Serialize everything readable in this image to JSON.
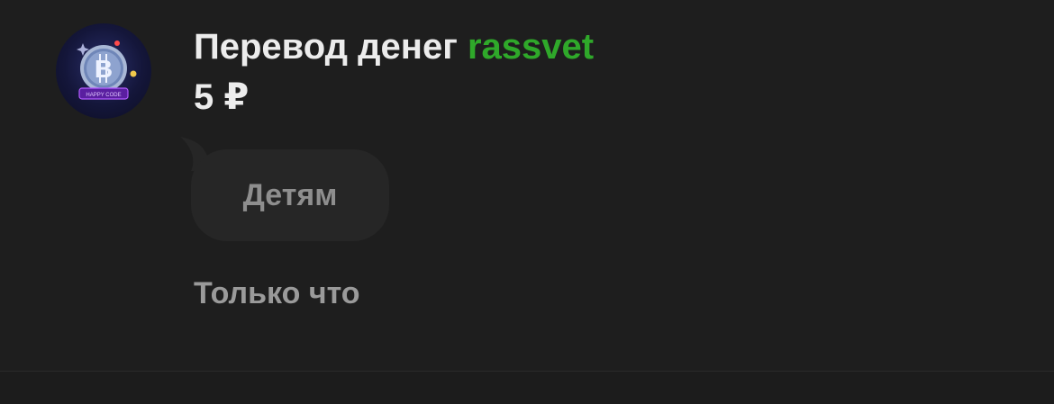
{
  "notification": {
    "avatar_icon": "bitcoin-logo-icon",
    "avatar_badge_text": "HAPPY CODE",
    "title_prefix": "Перевод денег",
    "username": "rassvet",
    "amount": "5 ₽",
    "message": "Детям",
    "timestamp": "Только что"
  },
  "colors": {
    "background": "#1e1e1e",
    "username": "#2fa82a",
    "title": "#ececec",
    "bubble": "#262626",
    "bubble_text": "#8e8e8e",
    "timestamp": "#9a9a9a"
  }
}
